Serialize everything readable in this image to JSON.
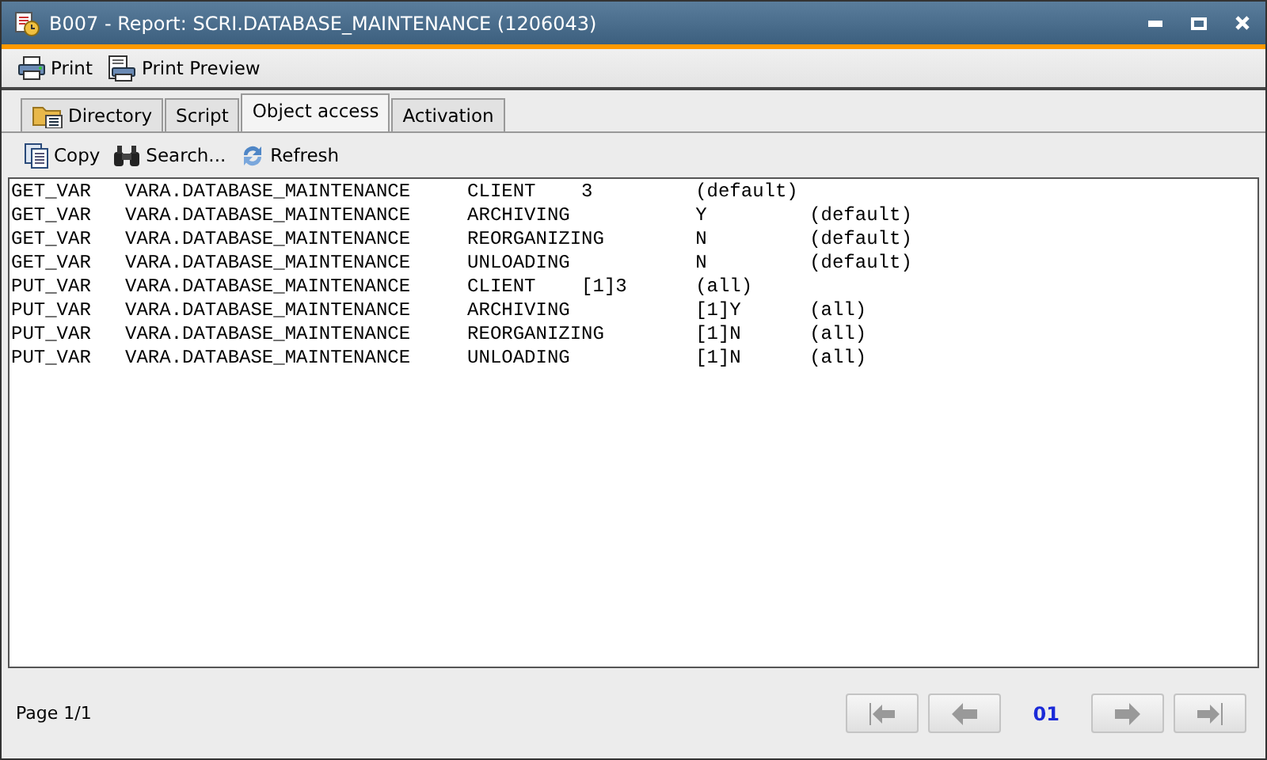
{
  "window": {
    "title": "B007 - Report: SCRI.DATABASE_MAINTENANCE (1206043)"
  },
  "toolbar": [
    {
      "kind": "print",
      "label": "Print"
    },
    {
      "kind": "preview",
      "label": "Print Preview"
    }
  ],
  "tabs": [
    {
      "kind": "folder",
      "label": "Directory",
      "selected": false
    },
    {
      "label": "Script",
      "selected": false
    },
    {
      "label": "Object access",
      "selected": true
    },
    {
      "label": "Activation",
      "selected": false
    }
  ],
  "actions": [
    {
      "kind": "copy",
      "label": "Copy"
    },
    {
      "kind": "search",
      "label": "Search..."
    },
    {
      "kind": "refresh",
      "label": "Refresh"
    }
  ],
  "report_lines": [
    "GET_VAR   VARA.DATABASE_MAINTENANCE     CLIENT    3         (default)",
    "GET_VAR   VARA.DATABASE_MAINTENANCE     ARCHIVING           Y         (default)",
    "GET_VAR   VARA.DATABASE_MAINTENANCE     REORGANIZING        N         (default)",
    "GET_VAR   VARA.DATABASE_MAINTENANCE     UNLOADING           N         (default)",
    "PUT_VAR   VARA.DATABASE_MAINTENANCE     CLIENT    [1]3      (all)",
    "PUT_VAR   VARA.DATABASE_MAINTENANCE     ARCHIVING           [1]Y      (all)",
    "PUT_VAR   VARA.DATABASE_MAINTENANCE     REORGANIZING        [1]N      (all)",
    "PUT_VAR   VARA.DATABASE_MAINTENANCE     UNLOADING           [1]N      (all)"
  ],
  "footer": {
    "page_label": "Page 1/1",
    "page_number": "01",
    "pager": [
      {
        "kind": "first",
        "disabled": true
      },
      {
        "kind": "prev",
        "disabled": true
      },
      {
        "kind": "next",
        "disabled": true
      },
      {
        "kind": "last",
        "disabled": true
      }
    ]
  }
}
